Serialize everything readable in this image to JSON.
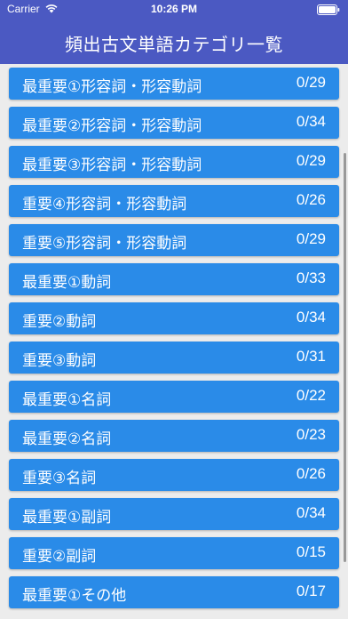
{
  "status_bar": {
    "carrier": "Carrier",
    "time": "10:26 PM"
  },
  "header": {
    "title": "頻出古文単語カテゴリ一覧"
  },
  "colors": {
    "header_bg": "#4b59c2",
    "row_bg": "#2a8be8",
    "page_bg": "#ececec"
  },
  "categories": [
    {
      "label": "最重要①形容詞・形容動詞",
      "count": "0/29"
    },
    {
      "label": "最重要②形容詞・形容動詞",
      "count": "0/34"
    },
    {
      "label": "最重要③形容詞・形容動詞",
      "count": "0/29"
    },
    {
      "label": "重要④形容詞・形容動詞",
      "count": "0/26"
    },
    {
      "label": "重要⑤形容詞・形容動詞",
      "count": "0/29"
    },
    {
      "label": "最重要①動詞",
      "count": "0/33"
    },
    {
      "label": "重要②動詞",
      "count": "0/34"
    },
    {
      "label": "重要③動詞",
      "count": "0/31"
    },
    {
      "label": "最重要①名詞",
      "count": "0/22"
    },
    {
      "label": "最重要②名詞",
      "count": "0/23"
    },
    {
      "label": "重要③名詞",
      "count": "0/26"
    },
    {
      "label": "最重要①副詞",
      "count": "0/34"
    },
    {
      "label": "重要②副詞",
      "count": "0/15"
    },
    {
      "label": "最重要①その他",
      "count": "0/17"
    }
  ]
}
